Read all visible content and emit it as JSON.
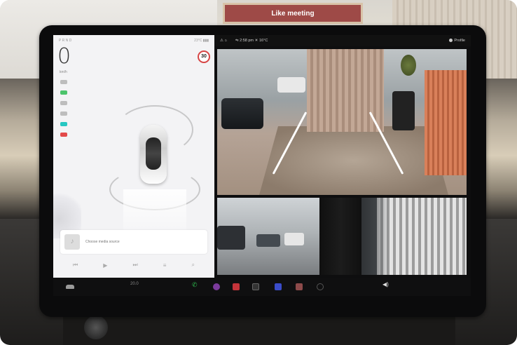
{
  "environment": {
    "sign_text": "Like meeting"
  },
  "driving_panel": {
    "status_left": "P R N D",
    "status_right": "23°C ▮▮▮",
    "speed": "0",
    "speed_unit": "km/h",
    "speed_limit": "30",
    "indicator_colors": [
      "#bdbdbd",
      "#4cc46c",
      "#bdbdbd",
      "#bdbdbd",
      "#27c7c2",
      "#e34a4a"
    ]
  },
  "media": {
    "source_label": "Choose media source",
    "controls": [
      "⏮",
      "▶",
      "⏭",
      "≡",
      "⌕"
    ]
  },
  "top_bar": {
    "left_icons": "⚠ ⌂",
    "center": "⇋  2:58 pm  ☀ 16°C",
    "profile": "Profile"
  },
  "camera": {
    "views": [
      "rear",
      "left-repeater",
      "right-repeater"
    ]
  },
  "dock": {
    "temperature": "20.0",
    "volume_icon": "◀)"
  }
}
